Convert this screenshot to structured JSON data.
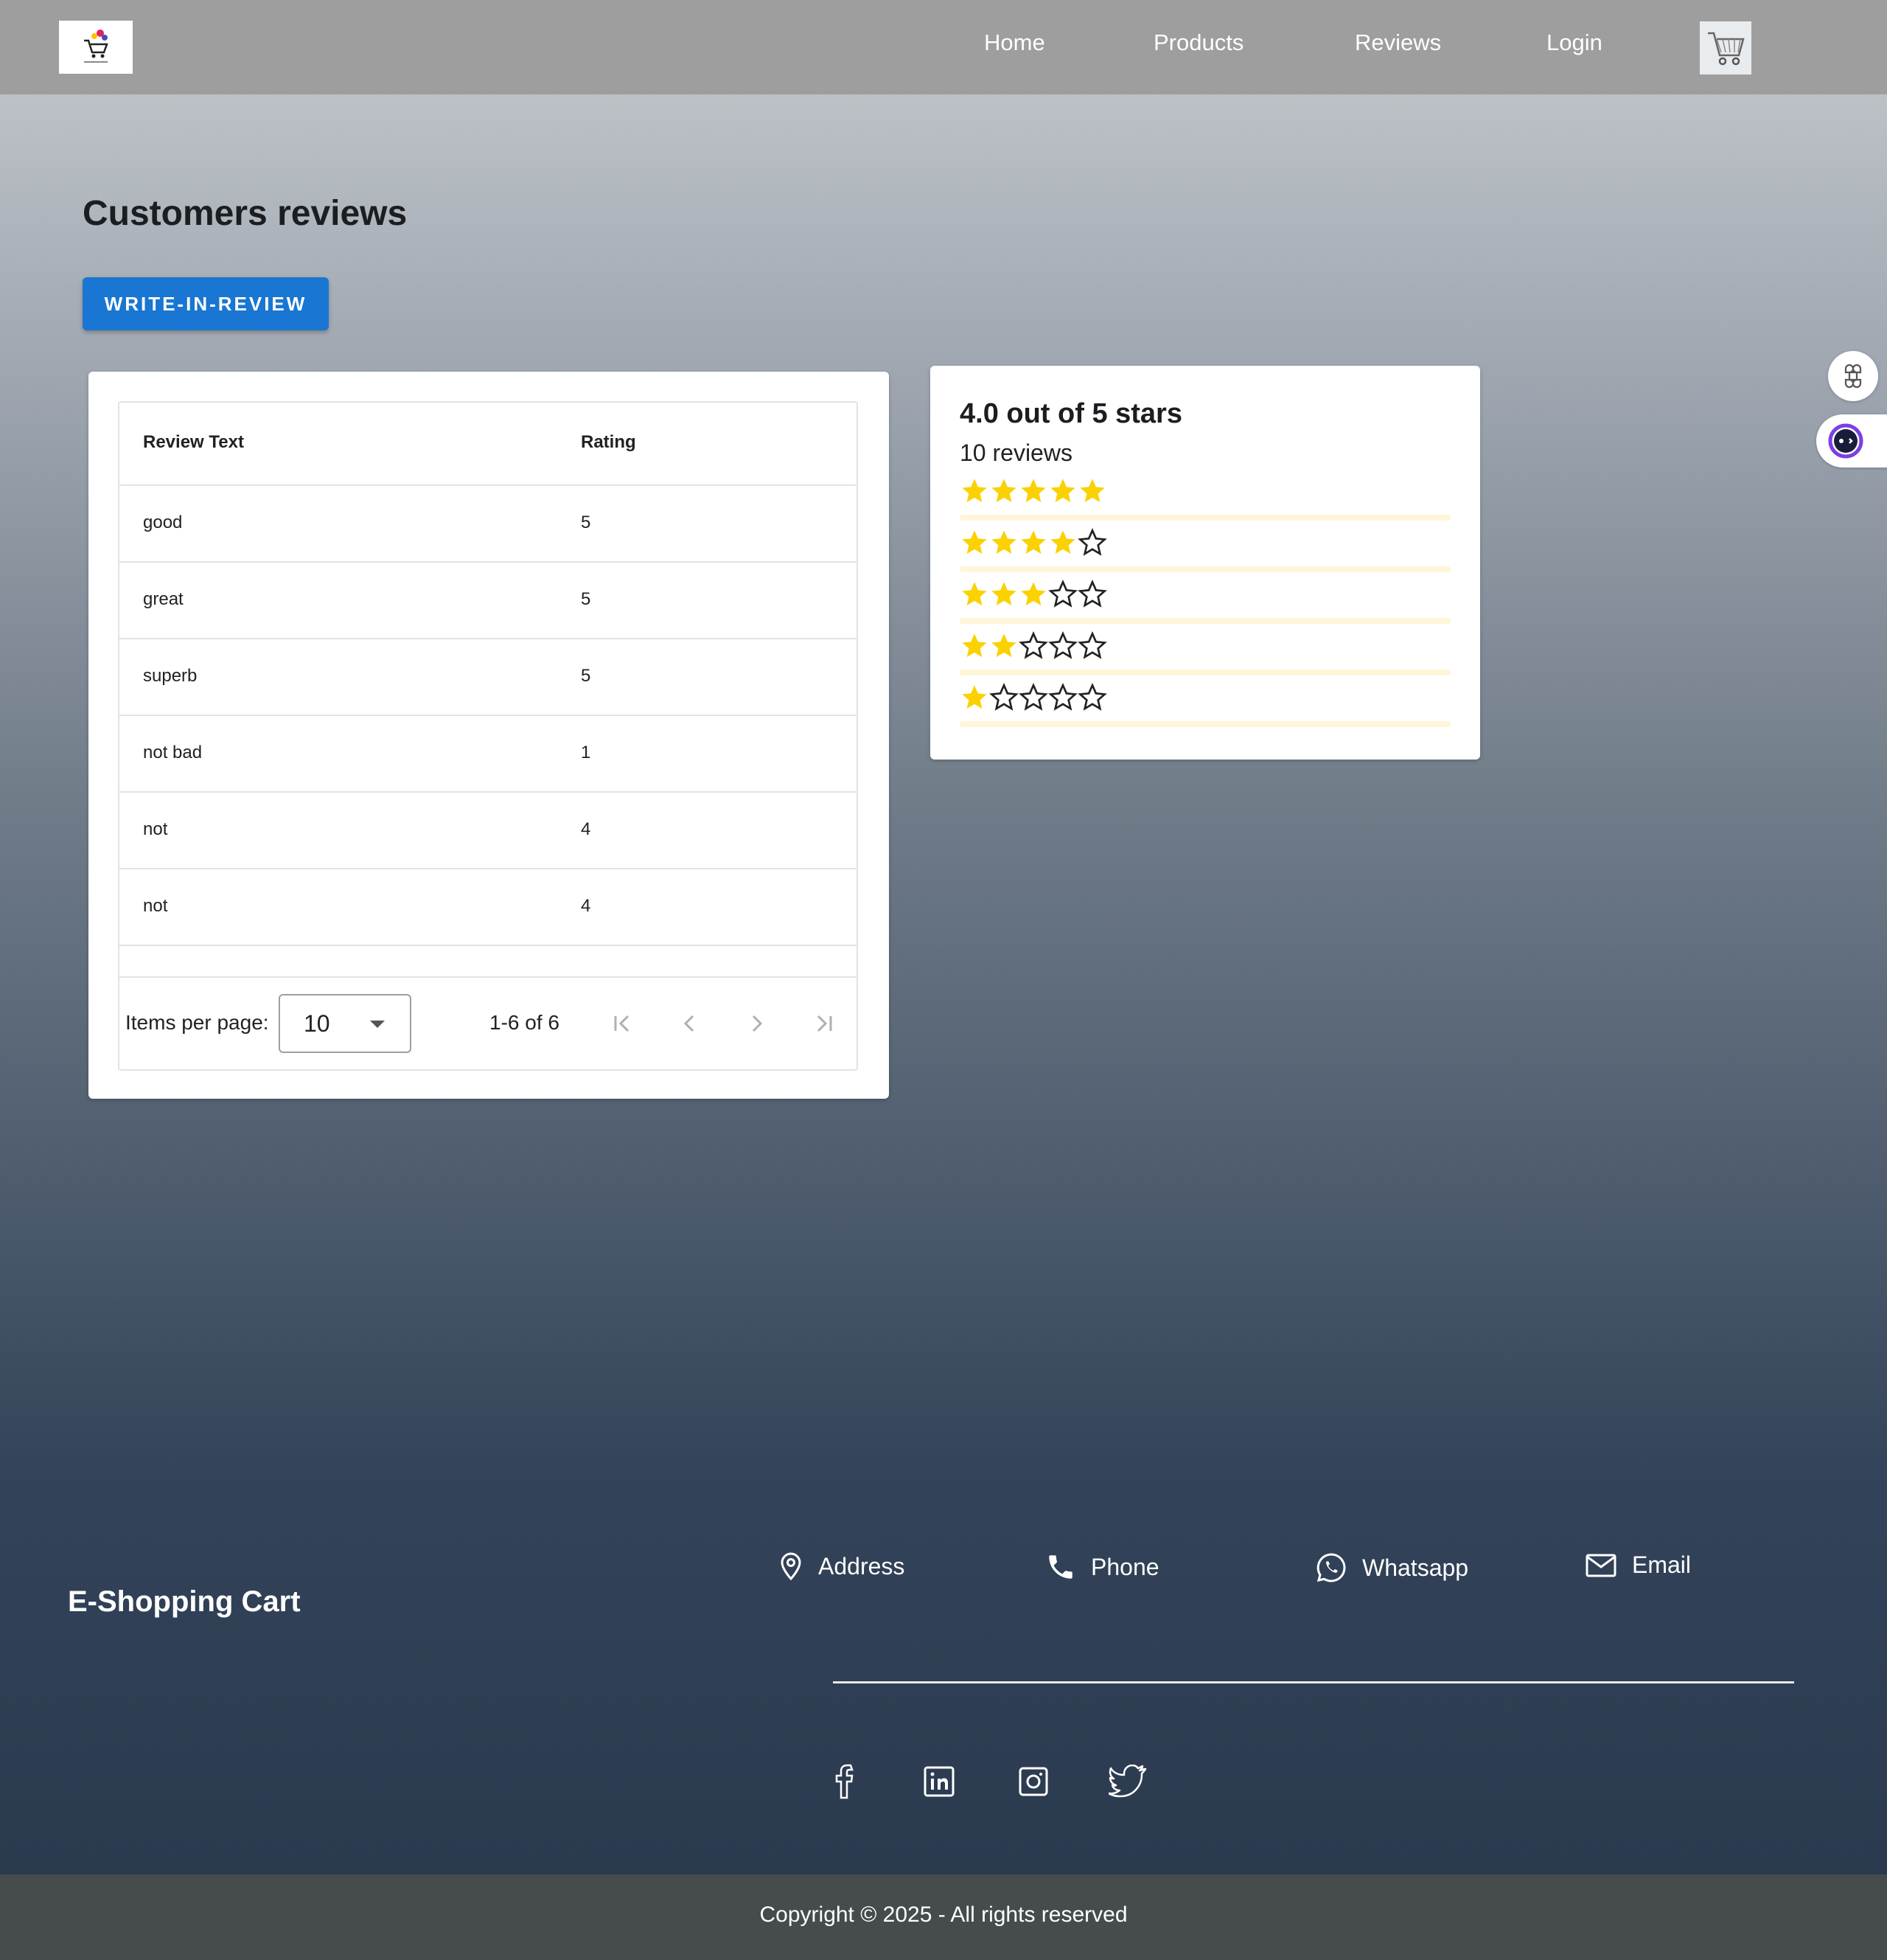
{
  "header": {
    "nav": [
      {
        "label": "Home"
      },
      {
        "label": "Products"
      },
      {
        "label": "Reviews"
      },
      {
        "label": "Login"
      }
    ]
  },
  "main": {
    "title": "Customers reviews",
    "write_button": "WRITE-IN-REVIEW"
  },
  "table": {
    "columns": [
      "Review Text",
      "Rating"
    ],
    "rows": [
      {
        "text": "good",
        "rating": "5"
      },
      {
        "text": "great",
        "rating": "5"
      },
      {
        "text": "superb",
        "rating": "5"
      },
      {
        "text": "not bad",
        "rating": "1"
      },
      {
        "text": "not",
        "rating": "4"
      },
      {
        "text": "not",
        "rating": "4"
      }
    ],
    "paginator": {
      "items_per_page_label": "Items per page:",
      "items_per_page": "10",
      "range": "1-6 of 6"
    }
  },
  "summary": {
    "title": "4.0 out of 5 stars",
    "count": "10 reviews",
    "rows": [
      {
        "stars": 5,
        "fill": 0
      },
      {
        "stars": 4,
        "fill": 0
      },
      {
        "stars": 3,
        "fill": 0
      },
      {
        "stars": 2,
        "fill": 0
      },
      {
        "stars": 1,
        "fill": 0
      }
    ],
    "star_color": "#fbd100",
    "bar_color": "#fff6da"
  },
  "footer": {
    "brand": "E-Shopping Cart",
    "contacts": {
      "address": "Address",
      "phone": "Phone",
      "whatsapp": "Whatsapp",
      "email": "Email"
    },
    "social": [
      "facebook-icon",
      "linkedin-icon",
      "instagram-icon",
      "twitter-icon"
    ],
    "copyright": "Copyright © 2025 - All rights reserved"
  },
  "colors": {
    "accent": "#1976d2",
    "header": "#9e9e9e",
    "footer_bar": "#464c4c"
  }
}
